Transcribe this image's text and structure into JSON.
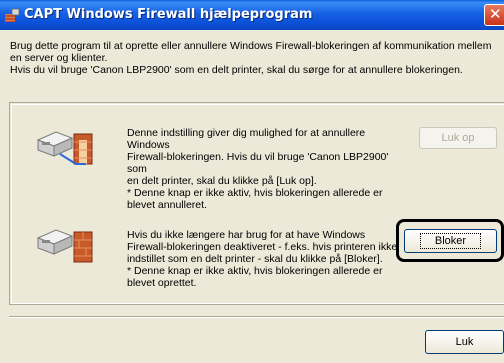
{
  "window": {
    "title": "CAPT Windows Firewall hjælpeprogram",
    "close_glyph": "✕"
  },
  "intro": {
    "line1": "Brug dette program til at oprette eller annullere Windows Firewall-blokeringen af kommunikation mellem",
    "line2": "en server og klienter.",
    "line3": "Hvis du vil bruge 'Canon LBP2900' som en delt printer, skal du sørge for at annullere blokeringen."
  },
  "unblock_section": {
    "icon": "firewall-open-icon",
    "line1": "Denne indstilling giver dig mulighed for at annullere Windows",
    "line2": "Firewall-blokeringen. Hvis du vil bruge 'Canon LBP2900' som",
    "line3": "en delt printer, skal du klikke på [Luk op].",
    "line4": "* Denne knap er ikke aktiv, hvis blokeringen allerede er",
    "line5": "blevet annulleret.",
    "button_label": "Luk op"
  },
  "block_section": {
    "icon": "firewall-closed-icon",
    "line1": "Hvis du ikke længere har brug for at have Windows",
    "line2": "Firewall-blokeringen deaktiveret - f.eks. hvis printeren ikke er",
    "line3": "indstillet som en delt printer - skal du klikke på [Bloker].",
    "line4": "* Denne knap er ikke aktiv, hvis blokeringen allerede er",
    "line5": "blevet oprettet.",
    "button_label": "Bloker"
  },
  "footer": {
    "close_button_label": "Luk"
  },
  "colors": {
    "titlebar": "#0b4fd6",
    "dialog_bg": "#ece9d8",
    "highlight": "#000000"
  }
}
